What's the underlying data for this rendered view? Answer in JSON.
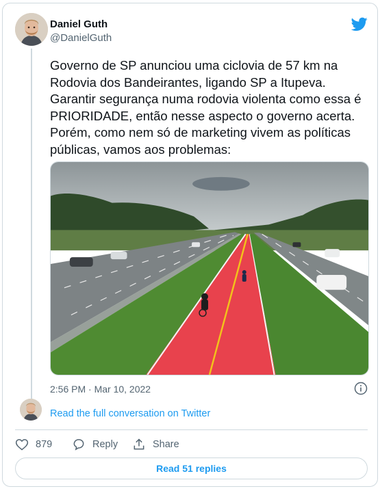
{
  "author": {
    "name": "Daniel Guth",
    "handle": "@DanielGuth"
  },
  "tweet": {
    "text": "Governo de SP anunciou uma ciclovia de 57 km na Rodovia dos Bandeirantes, ligando SP a Itupeva. Garantir segurança numa rodovia violenta como essa é PRIORIDADE, então nesse aspecto o governo acerta. Porém, como nem só de marketing vivem as políticas públicas, vamos aos problemas:",
    "timestamp": "2:56 PM · Mar 10, 2022"
  },
  "thread": {
    "read_conversation_label": "Read the full conversation on Twitter"
  },
  "actions": {
    "like_count": "879",
    "reply_label": "Reply",
    "share_label": "Share"
  },
  "footer": {
    "read_replies_label": "Read 51 replies"
  },
  "icons": {
    "brand": "twitter-bird-icon",
    "info": "info-icon",
    "like": "heart-icon",
    "reply": "speech-bubble-icon",
    "share": "share-upload-icon"
  },
  "colors": {
    "accent": "#1d9bf0",
    "secondary_text": "#536471",
    "border": "#cfd9de",
    "bike_lane": "#e8424d"
  }
}
